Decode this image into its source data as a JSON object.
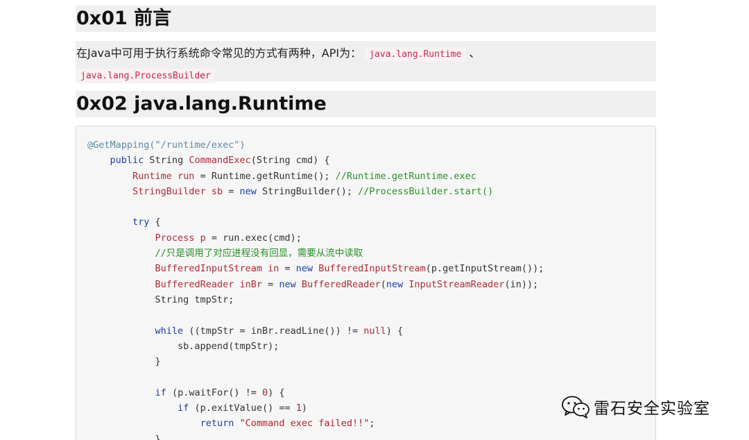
{
  "headings": {
    "intro": "0x01 前言",
    "runtime": "0x02 java.lang.Runtime"
  },
  "intro_paragraph": {
    "text": "在Java中可用于执行系统命令常见的方式有两种，API为：",
    "code1": "java.lang.Runtime",
    "separator": "、",
    "code2": "java.lang.ProcessBuilder"
  },
  "code_lines": [
    [
      {
        "t": "ann",
        "v": "@GetMapping(\"/runtime/exec\")"
      }
    ],
    [
      {
        "t": "plain",
        "v": "    "
      },
      {
        "t": "kw",
        "v": "public"
      },
      {
        "t": "plain",
        "v": " String "
      },
      {
        "t": "fn",
        "v": "CommandExec"
      },
      {
        "t": "plain",
        "v": "(String cmd) {"
      }
    ],
    [
      {
        "t": "plain",
        "v": "        "
      },
      {
        "t": "type",
        "v": "Runtime run"
      },
      {
        "t": "plain",
        "v": " = Runtime.getRuntime(); "
      },
      {
        "t": "com",
        "v": "//Runtime.getRuntime.exec"
      }
    ],
    [
      {
        "t": "plain",
        "v": "        "
      },
      {
        "t": "type",
        "v": "StringBuilder sb"
      },
      {
        "t": "plain",
        "v": " = "
      },
      {
        "t": "kw",
        "v": "new"
      },
      {
        "t": "plain",
        "v": " StringBuilder(); "
      },
      {
        "t": "com",
        "v": "//ProcessBuilder.start()"
      }
    ],
    [
      {
        "t": "plain",
        "v": ""
      }
    ],
    [
      {
        "t": "plain",
        "v": "        "
      },
      {
        "t": "kw",
        "v": "try"
      },
      {
        "t": "plain",
        "v": " {"
      }
    ],
    [
      {
        "t": "plain",
        "v": "            "
      },
      {
        "t": "type",
        "v": "Process p"
      },
      {
        "t": "plain",
        "v": " = run.exec(cmd);"
      }
    ],
    [
      {
        "t": "plain",
        "v": "            "
      },
      {
        "t": "com",
        "v": "//只是调用了对应进程没有回显，需要从流中读取"
      }
    ],
    [
      {
        "t": "plain",
        "v": "            "
      },
      {
        "t": "type",
        "v": "BufferedInputStream in"
      },
      {
        "t": "plain",
        "v": " = "
      },
      {
        "t": "kw",
        "v": "new"
      },
      {
        "t": "plain",
        "v": " "
      },
      {
        "t": "type",
        "v": "BufferedInputStream"
      },
      {
        "t": "plain",
        "v": "(p.getInputStream());"
      }
    ],
    [
      {
        "t": "plain",
        "v": "            "
      },
      {
        "t": "type",
        "v": "BufferedReader inBr"
      },
      {
        "t": "plain",
        "v": " = "
      },
      {
        "t": "kw",
        "v": "new"
      },
      {
        "t": "plain",
        "v": " "
      },
      {
        "t": "type",
        "v": "BufferedReader"
      },
      {
        "t": "plain",
        "v": "("
      },
      {
        "t": "kw",
        "v": "new"
      },
      {
        "t": "plain",
        "v": " "
      },
      {
        "t": "type",
        "v": "InputStreamReader"
      },
      {
        "t": "plain",
        "v": "(in));"
      }
    ],
    [
      {
        "t": "plain",
        "v": "            String tmpStr;"
      }
    ],
    [
      {
        "t": "plain",
        "v": ""
      }
    ],
    [
      {
        "t": "plain",
        "v": "            "
      },
      {
        "t": "kw",
        "v": "while"
      },
      {
        "t": "plain",
        "v": " ((tmpStr = inBr.readLine()) != "
      },
      {
        "t": "type",
        "v": "null"
      },
      {
        "t": "plain",
        "v": ") {"
      }
    ],
    [
      {
        "t": "plain",
        "v": "                sb.append(tmpStr);"
      }
    ],
    [
      {
        "t": "plain",
        "v": "            }"
      }
    ],
    [
      {
        "t": "plain",
        "v": ""
      }
    ],
    [
      {
        "t": "plain",
        "v": "            "
      },
      {
        "t": "kw",
        "v": "if"
      },
      {
        "t": "plain",
        "v": " (p.waitFor() != "
      },
      {
        "t": "num",
        "v": "0"
      },
      {
        "t": "plain",
        "v": ") {"
      }
    ],
    [
      {
        "t": "plain",
        "v": "                "
      },
      {
        "t": "kw",
        "v": "if"
      },
      {
        "t": "plain",
        "v": " (p.exitValue() == "
      },
      {
        "t": "num",
        "v": "1"
      },
      {
        "t": "plain",
        "v": ")"
      }
    ],
    [
      {
        "t": "plain",
        "v": "                    "
      },
      {
        "t": "kw",
        "v": "return"
      },
      {
        "t": "plain",
        "v": " "
      },
      {
        "t": "str",
        "v": "\"Command exec failed!!\""
      },
      {
        "t": "plain",
        "v": ";"
      }
    ],
    [
      {
        "t": "plain",
        "v": "            }"
      }
    ]
  ],
  "watermark": {
    "text": "雷石安全实验室",
    "icon": "wechat-icon"
  },
  "colors": {
    "heading_bg": "#efefef",
    "code_bg": "#f6f6f6",
    "keyword": "#1a3da8",
    "type": "#b02a37",
    "comment": "#2a8f2a",
    "annotation": "#5e8aa6"
  }
}
